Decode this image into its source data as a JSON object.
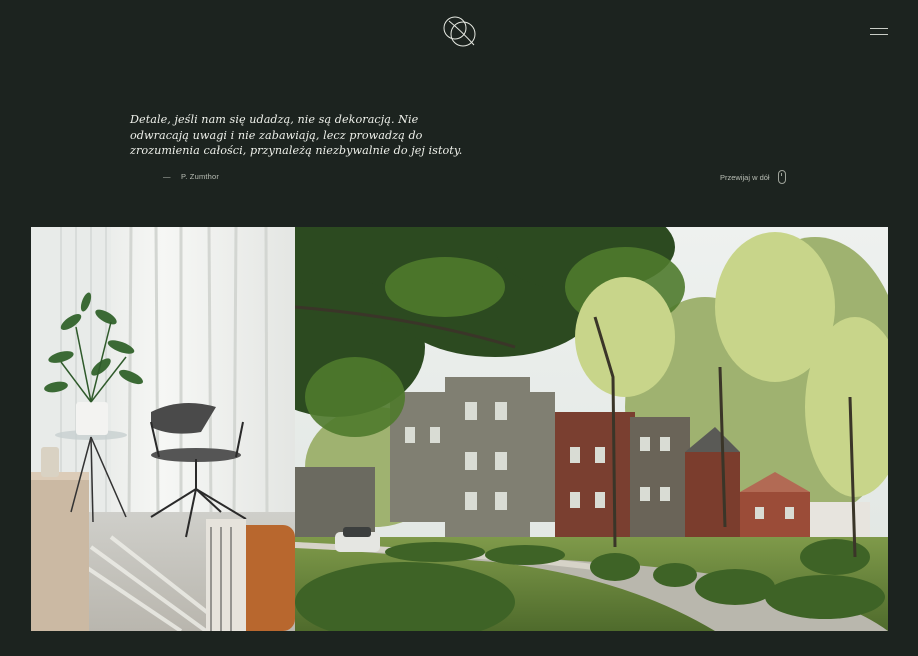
{
  "header": {
    "logo_icon": "interlocking-circles-logo",
    "menu_icon": "hamburger-icon"
  },
  "quote": {
    "text": "Detale, jeśli nam się udadzą, nie są dekoracją. Nie odwracają uwagi i nie zabawiają, lecz prowadzą do zrozumienia całości, przynależą niezbywalnie do jej istoty.",
    "author_dash": "—",
    "author": "P. Zumthor"
  },
  "scroll_hint": {
    "label": "Przewijaj w dół",
    "icon": "mouse-scroll-icon"
  },
  "gallery": {
    "left_image": "interior-chair-plant-photo",
    "right_image": "apartment-buildings-trees-photo"
  },
  "colors": {
    "background": "#1c231f",
    "text": "#eef0ea",
    "muted": "#b9beb5"
  }
}
